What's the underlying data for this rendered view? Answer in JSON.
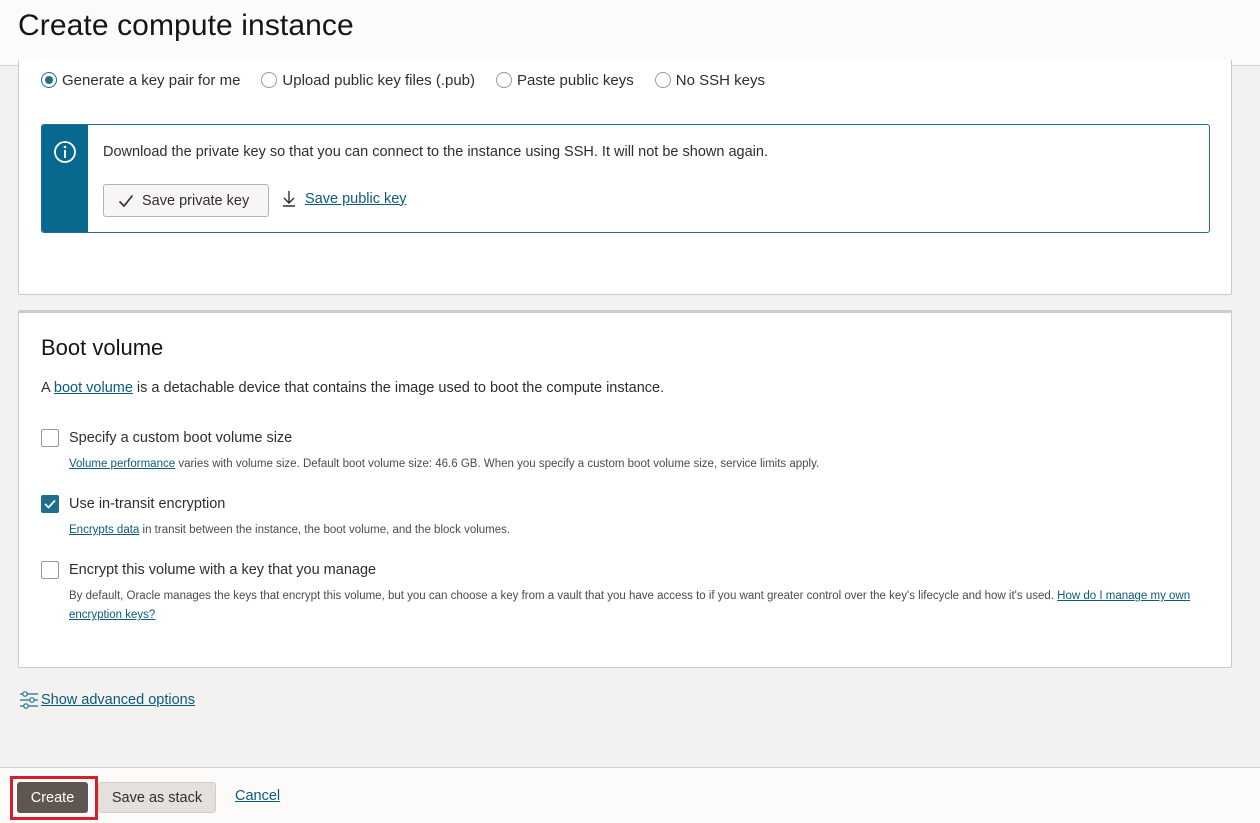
{
  "page": {
    "title": "Create compute instance"
  },
  "ssh": {
    "options": [
      {
        "label": "Generate a key pair for me",
        "checked": true
      },
      {
        "label": "Upload public key files (.pub)",
        "checked": false
      },
      {
        "label": "Paste public keys",
        "checked": false
      },
      {
        "label": "No SSH keys",
        "checked": false
      }
    ],
    "info_text": "Download the private key so that you can connect to the instance using SSH. It will not be shown again.",
    "save_private_label": "Save private key",
    "save_public_label": "Save public key"
  },
  "boot_volume": {
    "title": "Boot volume",
    "desc_prefix": "A ",
    "desc_link": "boot volume",
    "desc_suffix": " is a detachable device that contains the image used to boot the compute instance.",
    "custom_size": {
      "label": "Specify a custom boot volume size",
      "checked": false,
      "help_link": "Volume performance",
      "help_text": " varies with volume size. Default boot volume size: 46.6 GB. When you specify a custom boot volume size, service limits apply."
    },
    "in_transit": {
      "label": "Use in-transit encryption",
      "checked": true,
      "help_link": "Encrypts data",
      "help_text": " in transit between the instance, the boot volume, and the block volumes."
    },
    "own_key": {
      "label": "Encrypt this volume with a key that you manage",
      "checked": false,
      "help_text": "By default, Oracle manages the keys that encrypt this volume, but you can choose a key from a vault that you have access to if you want greater control over the key's lifecycle and how it's used. ",
      "help_link": "How do I manage my own encryption keys?"
    }
  },
  "advanced": {
    "label": "Show advanced options"
  },
  "footer": {
    "create_label": "Create",
    "stack_label": "Save as stack",
    "cancel_label": "Cancel"
  },
  "colors": {
    "accent": "#1e6e8f",
    "info_strip": "#08698e",
    "link": "#0b5b7a",
    "primary_button": "#5f5652",
    "highlight_outline": "#d3202c"
  }
}
